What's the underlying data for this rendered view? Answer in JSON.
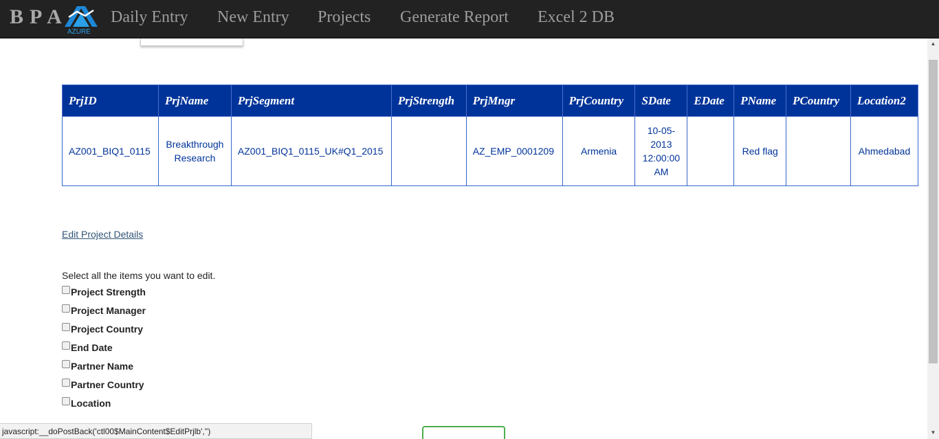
{
  "navbar": {
    "brand": "BPA",
    "logo_text": "AZURE",
    "links": [
      "Daily Entry",
      "New Entry",
      "Projects",
      "Generate Report",
      "Excel 2 DB"
    ]
  },
  "grid": {
    "headers": [
      "PrjID",
      "PrjName",
      "PrjSegment",
      "PrjStrength",
      "PrjMngr",
      "PrjCountry",
      "SDate",
      "EDate",
      "PName",
      "PCountry",
      "Location2"
    ],
    "row": {
      "prjid": "AZ001_BIQ1_0115",
      "prjname_1": "Breakthrough",
      "prjname_2": "Research",
      "prjsegment": "AZ001_BIQ1_0115_UK#Q1_2015",
      "prjstrength": "",
      "prjmngr": "AZ_EMP_0001209",
      "prjcountry": "Armenia",
      "sdate_1": "10-05-",
      "sdate_2": "2013",
      "sdate_3": "12:00:00",
      "sdate_4": "AM",
      "edate": "",
      "pname": "Red flag",
      "pcountry": "",
      "location2": "Ahmedabad"
    }
  },
  "edit_link": "Edit Project Details",
  "instructions": "Select all the items you want to edit.",
  "checkboxes": [
    "Project Strength",
    "Project Manager",
    "Project Country",
    "End Date",
    "Partner Name",
    "Partner Country",
    "Location"
  ],
  "status_bar": "javascript:__doPostBack('ctl00$MainContent$EditPrjlb','')",
  "colors": {
    "navbar_bg": "#222222",
    "header_bg": "#003399",
    "cell_text": "#003399",
    "button_border": "#4cae4c"
  }
}
